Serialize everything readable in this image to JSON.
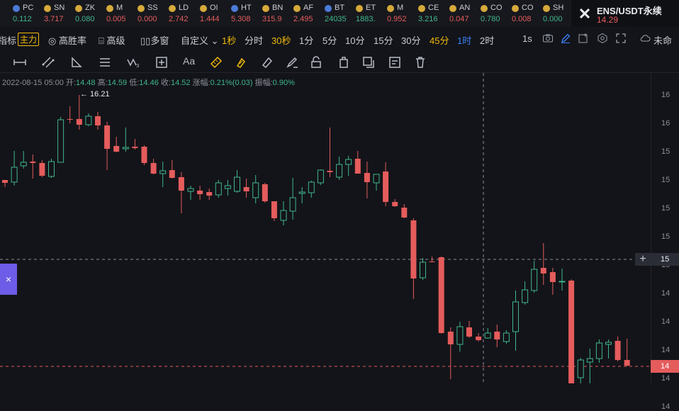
{
  "colors": {
    "up": "#3fb68b",
    "down": "#e55c5c",
    "accent": "#f0b90b",
    "selected": "#3b82f6",
    "crosshair": "#8b8f99",
    "background": "#131419"
  },
  "tickers": [
    {
      "icon": "blue-coin-icon",
      "name": "PC",
      "price": "0.112",
      "dir": "up"
    },
    {
      "icon": "gold-coin-icon",
      "name": "SN",
      "price": "3.717",
      "dir": "dn"
    },
    {
      "icon": "gold-coin-icon",
      "name": "ZK",
      "price": "0.080",
      "dir": "up"
    },
    {
      "icon": "gold-coin-icon",
      "name": "M",
      "price": "0.005",
      "dir": "dn"
    },
    {
      "icon": "gold-coin-icon",
      "name": "SS",
      "price": "0.000",
      "dir": "dn"
    },
    {
      "icon": "gold-coin-icon",
      "name": "LD",
      "price": "2.742",
      "dir": "dn"
    },
    {
      "icon": "gold-coin-icon",
      "name": "OI",
      "price": "1.444",
      "dir": "dn"
    },
    {
      "icon": "blue-coin-icon",
      "name": "HT",
      "price": "5.308",
      "dir": "dn"
    },
    {
      "icon": "gold-coin-icon",
      "name": "BN",
      "price": "315.9",
      "dir": "dn"
    },
    {
      "icon": "gold-coin-icon",
      "name": "AF",
      "price": "2.495",
      "dir": "dn"
    },
    {
      "icon": "blue-coin-icon",
      "name": "BT",
      "price": "24035",
      "dir": "up"
    },
    {
      "icon": "gold-coin-icon",
      "name": "ET",
      "price": "1883.",
      "dir": "up"
    },
    {
      "icon": "gold-coin-icon",
      "name": "M",
      "price": "0.952",
      "dir": "dn"
    },
    {
      "icon": "gold-coin-icon",
      "name": "CE",
      "price": "3.216",
      "dir": "up"
    },
    {
      "icon": "gold-coin-icon",
      "name": "AN",
      "price": "0.047",
      "dir": "dn"
    },
    {
      "icon": "gold-coin-icon",
      "name": "CO",
      "price": "0.780",
      "dir": "up"
    },
    {
      "icon": "gold-coin-icon",
      "name": "CO",
      "price": "0.008",
      "dir": "dn"
    },
    {
      "icon": "gold-coin-icon",
      "name": "SH",
      "price": "0.000",
      "dir": "up"
    }
  ],
  "pair": {
    "symbol": "ENS/USDT永续",
    "price": "14.29"
  },
  "toolbar": {
    "indicators": "指标",
    "main_force": "主力",
    "high_win": "高胜率",
    "advanced": "高级",
    "multi_window": "多窗",
    "custom": "自定义",
    "intervals": [
      "1秒",
      "分时",
      "30秒",
      "1分",
      "5分",
      "10分",
      "15分",
      "30分",
      "45分",
      "1时",
      "2时"
    ],
    "active_intervals": [
      "1秒",
      "30秒",
      "45分"
    ],
    "selected_interval": "1时",
    "refresh": "1s",
    "unnamed": "未命"
  },
  "ohlc": {
    "time": "2022-08-15 05:00",
    "open_label": "开:",
    "open": "14.48",
    "high_label": "高:",
    "high": "14.59",
    "low_label": "低:",
    "low": "14.46",
    "close_label": "收:",
    "close": "14.52",
    "change_label": "涨幅:",
    "change": "0.21%(0.03)",
    "amp_label": "振幅:",
    "amp": "0.90%"
  },
  "chart": {
    "high_marker": "← 16.21",
    "left_tab": "×",
    "cross_tag": "+",
    "cross_price": "15",
    "last_price": "14",
    "axis_ticks": [
      "16",
      "16",
      "15",
      "15",
      "15",
      "15",
      "15",
      "14",
      "14",
      "14",
      "14",
      "14"
    ]
  },
  "chart_data": {
    "type": "candlestick",
    "candles": [
      {
        "o": 254,
        "h": 257,
        "l": 264,
        "c": 258
      },
      {
        "o": 257,
        "h": 213,
        "l": 262,
        "c": 236
      },
      {
        "o": 234,
        "h": 213,
        "l": 238,
        "c": 229
      },
      {
        "o": 228,
        "h": 218,
        "l": 252,
        "c": 230
      },
      {
        "o": 230,
        "h": 226,
        "l": 250,
        "c": 248
      },
      {
        "o": 249,
        "h": 224,
        "l": 251,
        "c": 228
      },
      {
        "o": 229,
        "h": 165,
        "l": 229,
        "c": 169
      },
      {
        "o": 168,
        "h": 150,
        "l": 174,
        "c": 168
      },
      {
        "o": 168,
        "h": 134,
        "l": 183,
        "c": 176
      },
      {
        "o": 176,
        "h": 160,
        "l": 178,
        "c": 164
      },
      {
        "o": 164,
        "h": 158,
        "l": 183,
        "c": 177
      },
      {
        "o": 177,
        "h": 172,
        "l": 240,
        "c": 210
      },
      {
        "o": 206,
        "h": 193,
        "l": 215,
        "c": 214
      },
      {
        "o": 210,
        "h": 180,
        "l": 214,
        "c": 208
      },
      {
        "o": 207,
        "h": 196,
        "l": 211,
        "c": 209
      },
      {
        "o": 207,
        "h": 205,
        "l": 233,
        "c": 230
      },
      {
        "o": 230,
        "h": 224,
        "l": 246,
        "c": 245
      },
      {
        "o": 245,
        "h": 228,
        "l": 264,
        "c": 241
      },
      {
        "o": 240,
        "h": 226,
        "l": 252,
        "c": 251
      },
      {
        "o": 250,
        "h": 243,
        "l": 301,
        "c": 269
      },
      {
        "o": 270,
        "h": 262,
        "l": 282,
        "c": 266
      },
      {
        "o": 269,
        "h": 262,
        "l": 282,
        "c": 274
      },
      {
        "o": 271,
        "h": 266,
        "l": 282,
        "c": 276
      },
      {
        "o": 275,
        "h": 254,
        "l": 279,
        "c": 258
      },
      {
        "o": 266,
        "h": 254,
        "l": 276,
        "c": 262
      },
      {
        "o": 270,
        "h": 240,
        "l": 272,
        "c": 250
      },
      {
        "o": 264,
        "h": 252,
        "l": 279,
        "c": 270
      },
      {
        "o": 279,
        "h": 247,
        "l": 287,
        "c": 258
      },
      {
        "o": 260,
        "h": 258,
        "l": 286,
        "c": 284
      },
      {
        "o": 284,
        "h": 284,
        "l": 312,
        "c": 308
      },
      {
        "o": 311,
        "h": 284,
        "l": 318,
        "c": 297
      },
      {
        "o": 298,
        "h": 251,
        "l": 310,
        "c": 279
      },
      {
        "o": 273,
        "h": 264,
        "l": 287,
        "c": 271
      },
      {
        "o": 272,
        "h": 255,
        "l": 279,
        "c": 257
      },
      {
        "o": 258,
        "h": 239,
        "l": 261,
        "c": 240
      },
      {
        "o": 241,
        "h": 180,
        "l": 250,
        "c": 243
      },
      {
        "o": 250,
        "h": 221,
        "l": 254,
        "c": 232
      },
      {
        "o": 232,
        "h": 220,
        "l": 248,
        "c": 225
      },
      {
        "o": 224,
        "h": 213,
        "l": 245,
        "c": 245
      },
      {
        "o": 244,
        "h": 228,
        "l": 280,
        "c": 257
      },
      {
        "o": 258,
        "h": 247,
        "l": 269,
        "c": 246
      },
      {
        "o": 242,
        "h": 229,
        "l": 291,
        "c": 285
      },
      {
        "o": 285,
        "h": 281,
        "l": 292,
        "c": 291
      },
      {
        "o": 293,
        "h": 288,
        "l": 308,
        "c": 307
      },
      {
        "o": 311,
        "h": 308,
        "l": 422,
        "c": 393
      },
      {
        "o": 392,
        "h": 364,
        "l": 395,
        "c": 370
      },
      {
        "o": 369,
        "h": 362,
        "l": 370,
        "c": 369
      },
      {
        "o": 363,
        "h": 362,
        "l": 471,
        "c": 470
      },
      {
        "o": 468,
        "h": 462,
        "l": 535,
        "c": 486
      },
      {
        "o": 486,
        "h": 454,
        "l": 496,
        "c": 461
      },
      {
        "o": 462,
        "h": 453,
        "l": 477,
        "c": 475
      },
      {
        "o": 475,
        "h": 470,
        "l": 482,
        "c": 480
      },
      {
        "o": 477,
        "h": 463,
        "l": 478,
        "c": 470
      },
      {
        "o": 468,
        "h": 458,
        "l": 490,
        "c": 479
      },
      {
        "o": 482,
        "h": 466,
        "l": 485,
        "c": 470
      },
      {
        "o": 468,
        "h": 410,
        "l": 495,
        "c": 426
      },
      {
        "o": 427,
        "h": 397,
        "l": 430,
        "c": 409
      },
      {
        "o": 410,
        "h": 368,
        "l": 413,
        "c": 380
      },
      {
        "o": 378,
        "h": 343,
        "l": 402,
        "c": 386
      },
      {
        "o": 384,
        "h": 378,
        "l": 416,
        "c": 398
      },
      {
        "o": 398,
        "h": 379,
        "l": 410,
        "c": 397
      },
      {
        "o": 396,
        "h": 394,
        "l": 541,
        "c": 541
      },
      {
        "o": 533,
        "h": 505,
        "l": 541,
        "c": 508
      },
      {
        "o": 511,
        "h": 492,
        "l": 541,
        "c": 506
      },
      {
        "o": 506,
        "h": 479,
        "l": 512,
        "c": 484
      },
      {
        "o": 486,
        "h": 479,
        "l": 506,
        "c": 483
      },
      {
        "o": 481,
        "h": 475,
        "l": 510,
        "c": 508
      },
      {
        "o": 508,
        "h": 478,
        "l": 517,
        "c": 516
      }
    ]
  }
}
